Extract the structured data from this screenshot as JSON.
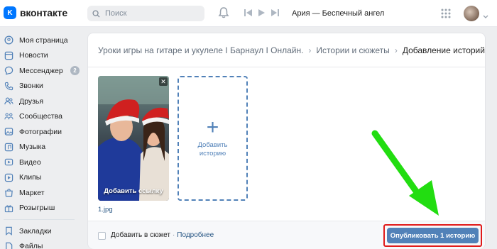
{
  "header": {
    "logo_letter": "K",
    "logo_text": "вконтакте",
    "search_placeholder": "Поиск",
    "now_playing": "Ария — Беспечный ангел"
  },
  "sidebar": {
    "items": [
      {
        "label": "Моя страница",
        "icon": "home-icon"
      },
      {
        "label": "Новости",
        "icon": "news-icon"
      },
      {
        "label": "Мессенджер",
        "icon": "chat-icon",
        "badge": "2"
      },
      {
        "label": "Звонки",
        "icon": "phone-icon"
      },
      {
        "label": "Друзья",
        "icon": "friends-icon"
      },
      {
        "label": "Сообщества",
        "icon": "groups-icon"
      },
      {
        "label": "Фотографии",
        "icon": "photo-icon"
      },
      {
        "label": "Музыка",
        "icon": "music-icon"
      },
      {
        "label": "Видео",
        "icon": "video-icon"
      },
      {
        "label": "Клипы",
        "icon": "clips-icon"
      },
      {
        "label": "Маркет",
        "icon": "market-icon"
      },
      {
        "label": "Розыгрыш",
        "icon": "gift-icon"
      }
    ],
    "bottom_items": [
      {
        "label": "Закладки",
        "icon": "bookmark-icon"
      },
      {
        "label": "Файлы",
        "icon": "file-icon"
      }
    ]
  },
  "breadcrumb": {
    "items": [
      "Уроки игры на гитаре и укулеле I Барнаул I Онлайн.",
      "Истории и сюжеты",
      "Добавление историй"
    ]
  },
  "story": {
    "caption": "Добавить ссылку",
    "close_glyph": "✕",
    "filename": "1.jpg"
  },
  "add_story": {
    "plus": "+",
    "label": "Добавить историю"
  },
  "footer": {
    "checkbox_label": "Добавить в сюжет",
    "dot": "·",
    "more_link": "Подробнее",
    "publish_label": "Опубликовать 1 историю"
  },
  "colors": {
    "accent": "#5181b8",
    "brand": "#0077ff",
    "highlight": "#e01a1a",
    "arrow": "#22dd11"
  }
}
